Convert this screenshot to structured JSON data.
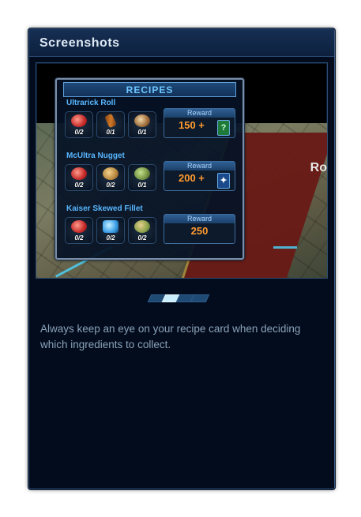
{
  "panel": {
    "title": "Screenshots"
  },
  "screenshot": {
    "edge_text": "Ro",
    "recipe_card": {
      "title": "RECIPES",
      "reward_label": "Reward",
      "recipes": [
        {
          "name": "Ultrarick Roll",
          "ingredients": [
            {
              "icon": "meat-icon",
              "count": "0/2"
            },
            {
              "icon": "stick-icon",
              "count": "0/1"
            },
            {
              "icon": "nugget-icon",
              "count": "0/1"
            }
          ],
          "reward": "150 +",
          "bonus_icon": "question-icon",
          "bonus_glyph": "?"
        },
        {
          "name": "McUltra Nugget",
          "ingredients": [
            {
              "icon": "meat-icon",
              "count": "0/2"
            },
            {
              "icon": "nugget-icon",
              "count": "0/2"
            },
            {
              "icon": "pod-icon",
              "count": "0/1"
            }
          ],
          "reward": "200 +",
          "bonus_icon": "star-icon",
          "bonus_glyph": "✦"
        },
        {
          "name": "Kaiser Skewed Fillet",
          "ingredients": [
            {
              "icon": "meat-icon",
              "count": "0/2"
            },
            {
              "icon": "crystal-icon",
              "count": "0/2"
            },
            {
              "icon": "leaf-icon",
              "count": "0/2"
            }
          ],
          "reward": "250"
        }
      ]
    }
  },
  "pager": {
    "total": 4,
    "active_index": 1
  },
  "caption": "Always keep an eye on your recipe card when deciding which ingredients to collect.",
  "colors": {
    "panel_bg": "#030c1c",
    "accent_blue": "#58b6ff",
    "reward_orange": "#ff9a2e"
  }
}
